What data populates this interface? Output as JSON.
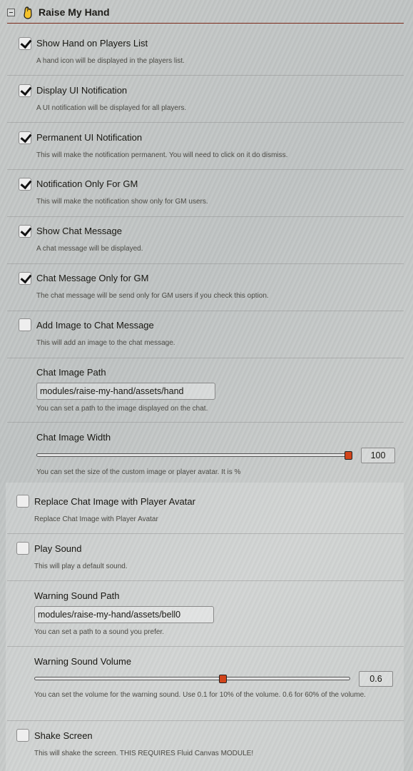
{
  "module": {
    "title": "Raise My Hand",
    "collapse_icon": "minus-square-icon",
    "icon": "raised-hand-icon",
    "accent_color": "#7a2a1a",
    "hand_color": "#f4c22b"
  },
  "settings": [
    {
      "label": "Show Hand on Players List",
      "hint": "A hand icon will be displayed in the players list.",
      "checked": true
    },
    {
      "label": "Display UI Notification",
      "hint": "A UI notification will be displayed for all players.",
      "checked": true
    },
    {
      "label": "Permanent UI Notification",
      "hint": "This will make the notification permanent. You will need to click on it do dismiss.",
      "checked": true
    },
    {
      "label": "Notification Only For GM",
      "hint": "This will make the notification show only for GM users.",
      "checked": true
    },
    {
      "label": "Show Chat Message",
      "hint": "A chat message will be displayed.",
      "checked": true
    },
    {
      "label": "Chat Message Only for GM",
      "hint": "The chat message will be send only for GM users if you check this option.",
      "checked": true
    },
    {
      "label": "Add Image to Chat Message",
      "hint": "This will add an image to the chat message.",
      "checked": false
    },
    {
      "label": "Chat Image Path",
      "hint": "You can set a path to the image displayed on the chat.",
      "value": "modules/raise-my-hand/assets/hand"
    },
    {
      "label": "Chat Image Width",
      "hint": "You can set the size of the custom image or player avatar. It is %",
      "value": "100",
      "fraction": 1.0
    },
    {
      "label": "Replace Chat Image with Player Avatar",
      "hint": "Replace Chat Image with Player Avatar",
      "checked": false
    },
    {
      "label": "Play Sound",
      "hint": "This will play a default sound.",
      "checked": false
    },
    {
      "label": "Warning Sound Path",
      "hint": "You can set a path to a sound you prefer.",
      "value": "modules/raise-my-hand/assets/bell0"
    },
    {
      "label": "Warning Sound Volume",
      "hint": "You can set the volume for the warning sound. Use 0.1 for 10% of the volume. 0.6 for 60% of the volume.",
      "value": "0.6",
      "fraction": 0.6
    },
    {
      "label": "Shake Screen",
      "hint": "This will shake the screen. THIS REQUIRES Fluid Canvas MODULE!",
      "checked": false
    }
  ]
}
